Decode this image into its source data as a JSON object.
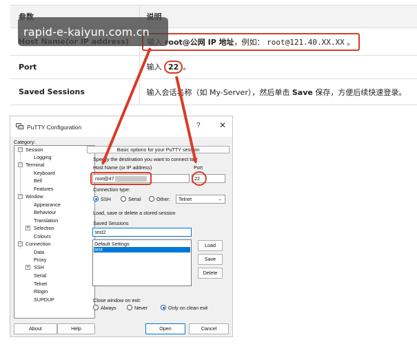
{
  "watermark": "rapid-e-kaiyun.com.cn",
  "doc_table": {
    "header": {
      "param": "参数",
      "desc": "说明"
    },
    "rows": [
      {
        "param": "Host Name(or IP address)",
        "desc_prefix": "输入",
        "desc_bold": "root@公网 IP 地址",
        "desc_mid": "，例如：",
        "desc_code": "root@121.40.XX.XX",
        "desc_suffix": "。"
      },
      {
        "param": "Port",
        "desc_prefix": "输入",
        "desc_value": "22",
        "desc_suffix": "。"
      },
      {
        "param": "Saved Sessions",
        "desc_prefix": "输入会话名称（如 My-Server），然后单击",
        "desc_bold": "Save",
        "desc_suffix": "保存，方便后续快速登录。"
      }
    ]
  },
  "putty": {
    "title": "PuTTY Configuration",
    "help_glyph": "?",
    "close_glyph": "✕",
    "category_label": "Category:",
    "tree": [
      {
        "label": "Session",
        "expander": "−"
      },
      {
        "label": "Logging"
      },
      {
        "label": "Terminal",
        "expander": "−"
      },
      {
        "label": "Keyboard"
      },
      {
        "label": "Bell"
      },
      {
        "label": "Features"
      },
      {
        "label": "Window",
        "expander": "−"
      },
      {
        "label": "Appearance"
      },
      {
        "label": "Behaviour"
      },
      {
        "label": "Translation"
      },
      {
        "label": "Selection",
        "expander": "+"
      },
      {
        "label": "Colours"
      },
      {
        "label": "Connection",
        "expander": "−"
      },
      {
        "label": "Data"
      },
      {
        "label": "Proxy"
      },
      {
        "label": "SSH",
        "expander": "+"
      },
      {
        "label": "Serial"
      },
      {
        "label": "Telnet"
      },
      {
        "label": "Rlogin"
      },
      {
        "label": "SUPDUP"
      }
    ],
    "panel_title": "Basic options for your PuTTY session",
    "destination_label": "Specify the destination you want to connect to",
    "host_label": "Host Name (or IP address)",
    "host_value": "root@47",
    "port_label": "Port",
    "port_value": "22",
    "conn_type_label": "Connection type:",
    "conn_types": [
      {
        "label": "SSH",
        "selected": true
      },
      {
        "label": "Serial",
        "selected": false
      },
      {
        "label": "Other:",
        "selected": false
      }
    ],
    "other_select": "Telnet",
    "sessions_group_label": "Load, save or delete a stored session",
    "saved_sessions_label": "Saved Sessions",
    "saved_sessions_value": "test2",
    "sessions_list": [
      {
        "label": "Default Settings",
        "selected": false
      },
      {
        "label": "test",
        "selected": true
      }
    ],
    "load_btn": "Load",
    "save_btn": "Save",
    "delete_btn": "Delete",
    "close_on_exit_label": "Close window on exit:",
    "close_options": [
      {
        "label": "Always",
        "selected": false
      },
      {
        "label": "Never",
        "selected": false
      },
      {
        "label": "Only on clean exit",
        "selected": true
      }
    ],
    "about_btn": "About",
    "help_btn": "Help",
    "open_btn": "Open",
    "cancel_btn": "Cancel"
  },
  "colors": {
    "highlight_red": "#d93a26",
    "selection_blue": "#0078d7",
    "watermark_bg": "#464646"
  }
}
